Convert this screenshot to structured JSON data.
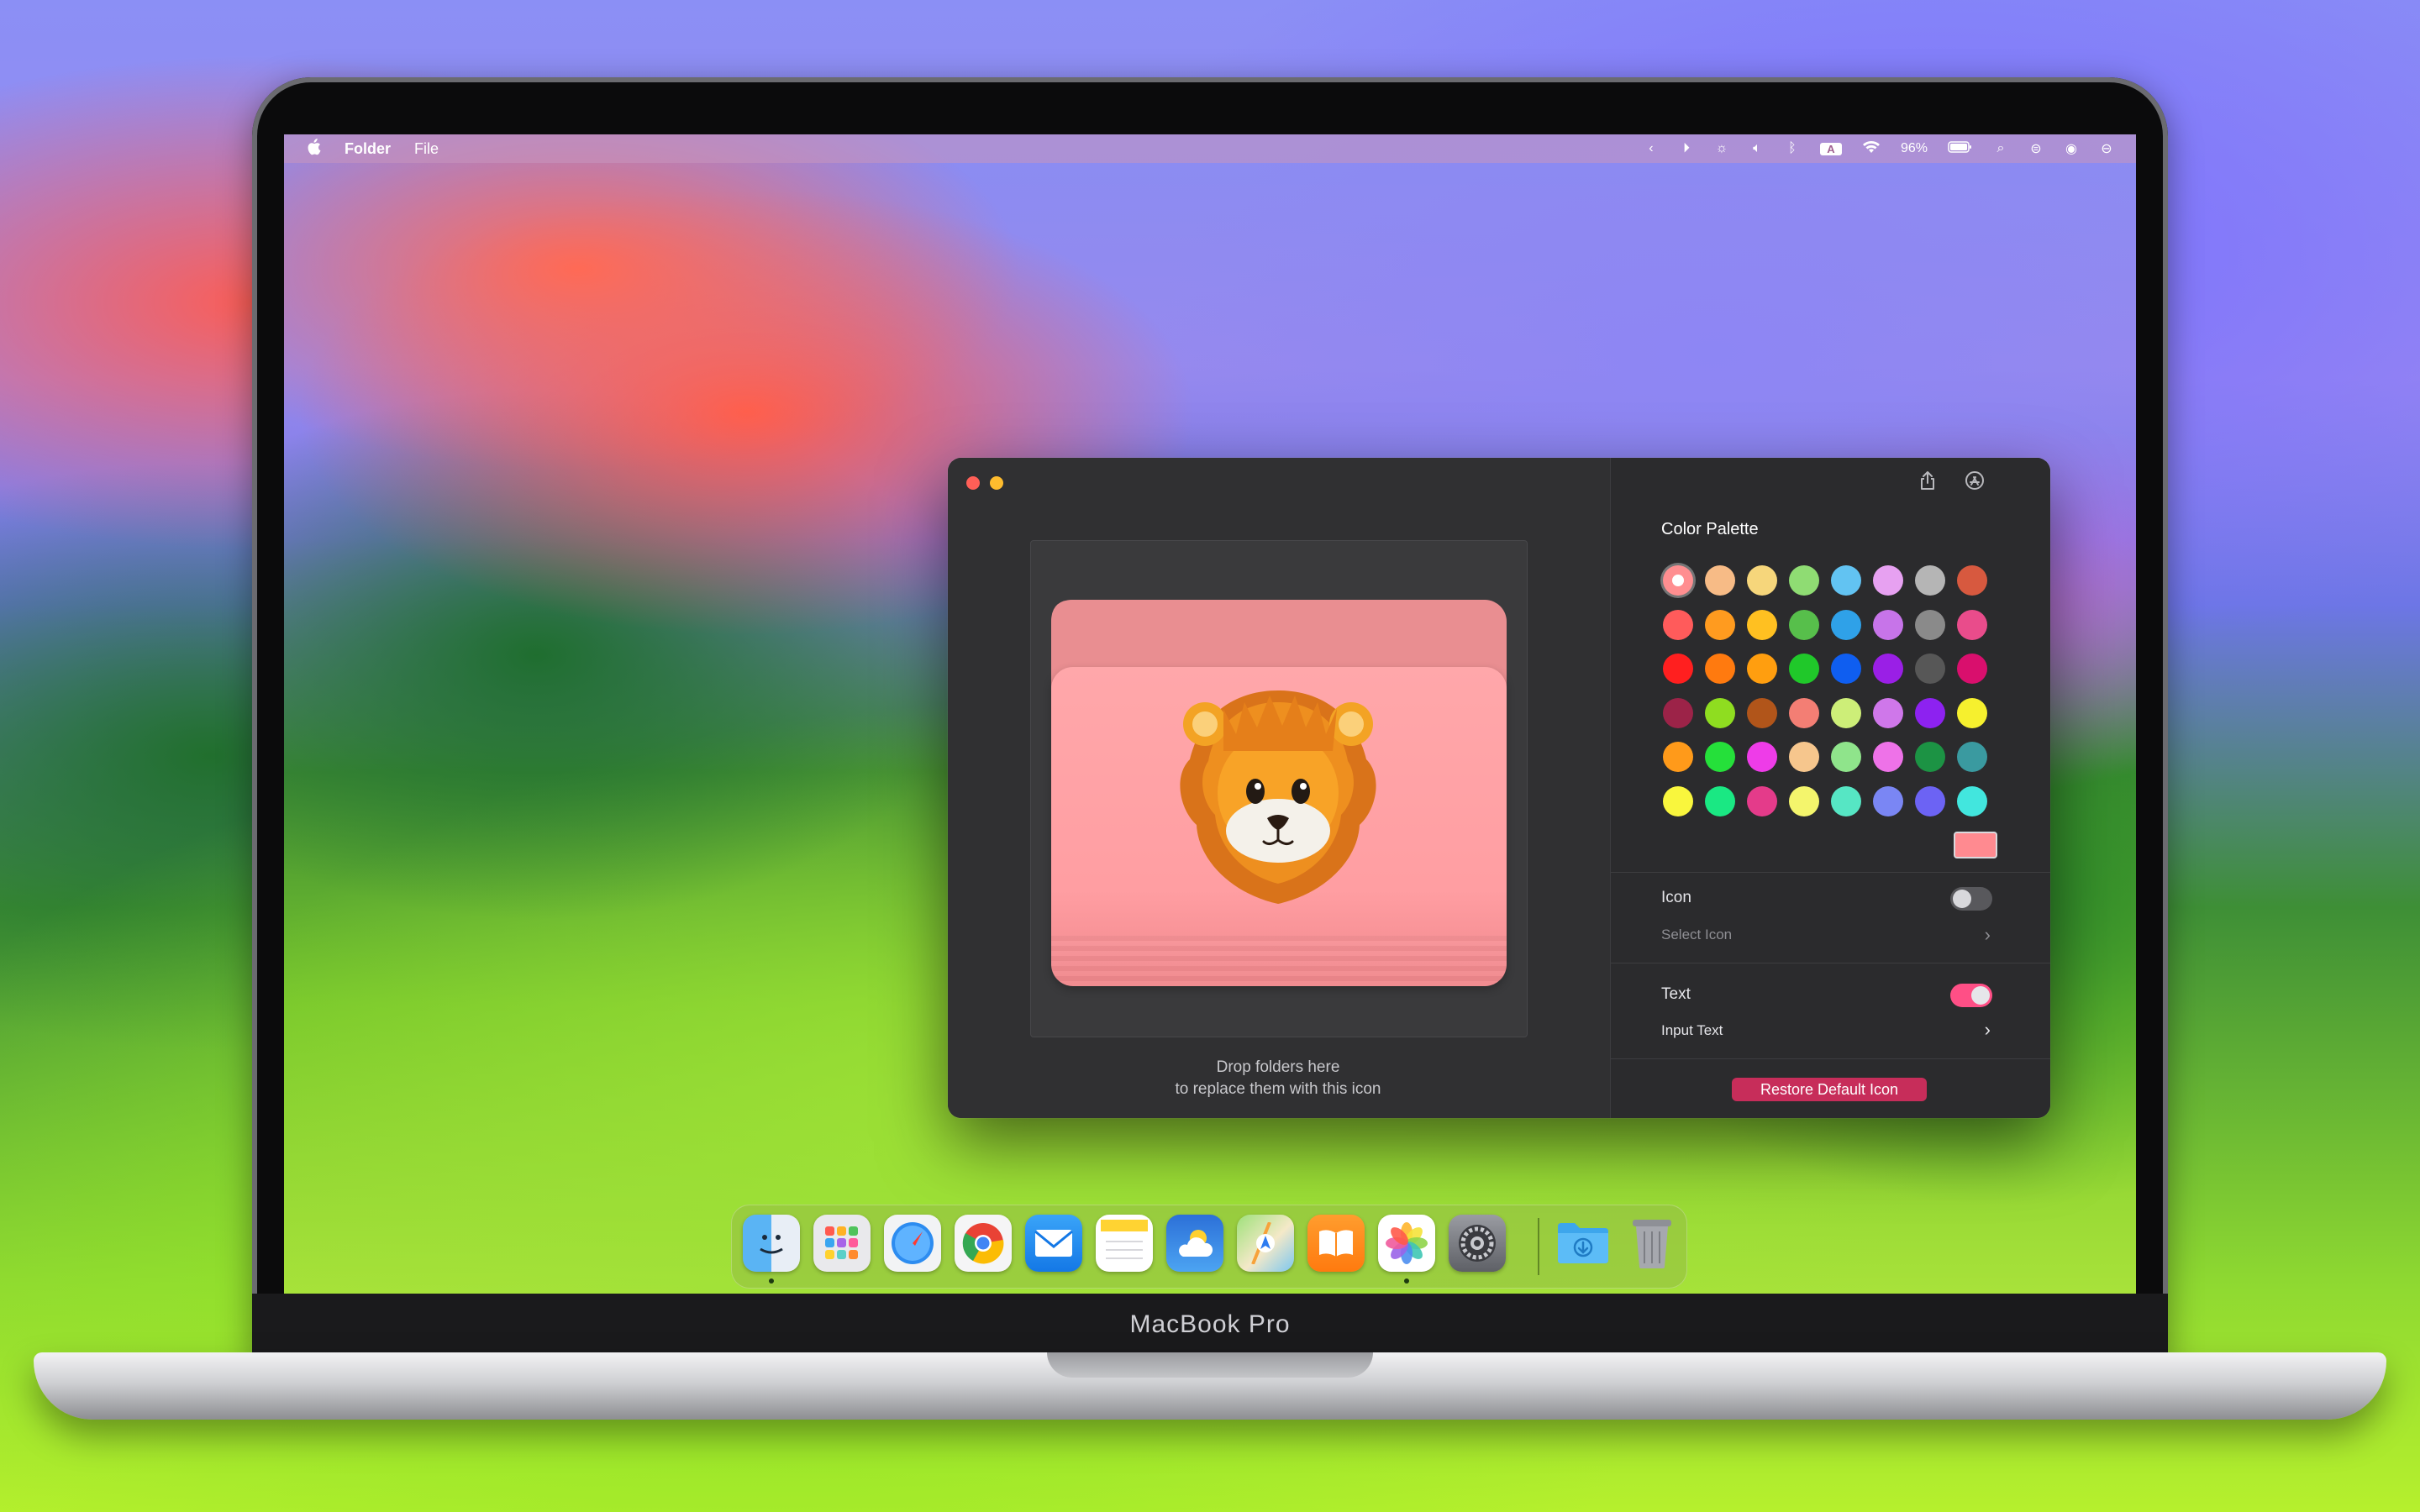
{
  "device_label": "MacBook Pro",
  "menubar": {
    "app_name": "Folder",
    "menus": [
      "File"
    ],
    "battery": "96%"
  },
  "window": {
    "drop_hint_line1": "Drop folders here",
    "drop_hint_line2": "to replace them with this icon",
    "color_palette_title": "Color Palette",
    "swatches": [
      "#ff8e90",
      "#f7bb86",
      "#f6d67b",
      "#8fdc73",
      "#62c3f2",
      "#e7a1f1",
      "#b5b5b5",
      "#d7593f",
      "#ff5b5b",
      "#ff9b1f",
      "#ffc021",
      "#57bf4b",
      "#2fa1e8",
      "#c774e9",
      "#8a8a8a",
      "#e94c8b",
      "#ff1f1f",
      "#ff7a0f",
      "#ff9e0f",
      "#20c82a",
      "#0f5ef0",
      "#9a1fe6",
      "#575757",
      "#d90f6d",
      "#9c2348",
      "#8fdd20",
      "#b1551a",
      "#f37e74",
      "#cdee78",
      "#cf77ea",
      "#8d22f0",
      "#f6f02e",
      "#ff9a1a",
      "#25e03a",
      "#ee3ce8",
      "#f6c68d",
      "#8fe48b",
      "#ee72e8",
      "#1c9344",
      "#3a9aa0",
      "#f9f63d",
      "#1ae883",
      "#e43b8a",
      "#f4f56c",
      "#56e6c4",
      "#7a86f4",
      "#6c63f4",
      "#42e6de"
    ],
    "selected_swatch_index": 0,
    "icon_label": "Icon",
    "icon_toggle_on": false,
    "select_icon_label": "Select Icon",
    "text_label": "Text",
    "text_toggle_on": true,
    "input_text_label": "Input Text",
    "restore_button": "Restore Default Icon",
    "accent_color": "#c72d5a"
  },
  "dock": {
    "apps": [
      "Finder",
      "Launchpad",
      "Safari",
      "Chrome",
      "Mail",
      "Notes",
      "Weather",
      "Maps",
      "Books",
      "Photos",
      "System Settings"
    ],
    "extras": [
      "Downloads",
      "Trash"
    ]
  }
}
